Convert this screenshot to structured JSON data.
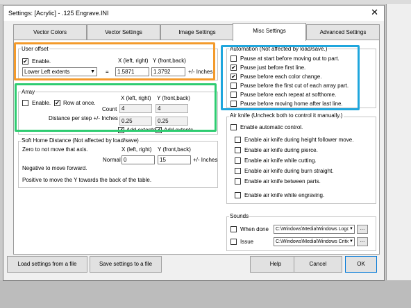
{
  "window": {
    "title": "Settings: [Acrylic] - .125 Engrave.INI",
    "close_glyph": "✕"
  },
  "tabs": [
    {
      "label": "Vector Colors",
      "active": false
    },
    {
      "label": "Vector Settings",
      "active": false
    },
    {
      "label": "Image Settings",
      "active": false
    },
    {
      "label": "Misc Settings",
      "active": true
    },
    {
      "label": "Advanced Settings",
      "active": false
    }
  ],
  "user_offset": {
    "title": "User offset",
    "enable_label": "Enable.",
    "enable_checked": true,
    "x_header": "X (left, right)",
    "y_header": "Y (front,back)",
    "mode_value": "Lower Left extents",
    "equals": "=",
    "x_value": "1.5871",
    "y_value": "1.3792",
    "units": "+/- Inches"
  },
  "array": {
    "title": "Array",
    "enable_label": "Enable.",
    "enable_checked": false,
    "row_label": "Row at once.",
    "row_checked": true,
    "x_header": "X (left, right)",
    "y_header": "Y (front,back)",
    "count_label": "Count",
    "count_x": "4",
    "count_y": "4",
    "distance_label": "Distance per step +/- Inches",
    "dist_x": "0.25",
    "dist_y": "0.25",
    "add_extents_x_label": "Add extents.",
    "add_extents_x_checked": true,
    "add_extents_y_label": "Add extents.",
    "add_extents_y_checked": true
  },
  "soft_home": {
    "title": "Soft Home Distance (Not affected by load/save)",
    "zero_note": "Zero to not move that axis.",
    "x_header": "X (left, right)",
    "y_header": "Y (front,back)",
    "normal_label": "Normal",
    "x_value": "0",
    "y_value": "15",
    "units": "+/- Inches",
    "negative_note": "Negative to move forward.",
    "positive_note": "Positive to move the Y towards the back of the table."
  },
  "automation": {
    "title": "Automation (Not affected by load/save.)",
    "items": [
      {
        "label": "Pause at start before moving out to part.",
        "checked": false
      },
      {
        "label": "Pause just before first line.",
        "checked": true
      },
      {
        "label": "Pause before each color change.",
        "checked": true
      },
      {
        "label": "Pause before the first cut of each array part.",
        "checked": false
      },
      {
        "label": "Pause before each repeat at softhome.",
        "checked": false
      },
      {
        "label": "Pause before moving home after last line.",
        "checked": false
      }
    ]
  },
  "air_knife": {
    "title": "Air knife (Uncheck both to control it manually.)",
    "auto_label": "Enable automatic control.",
    "auto_checked": false,
    "items": [
      {
        "label": "Enable air knife during height follower move.",
        "checked": false
      },
      {
        "label": "Enable air knife during pierce.",
        "checked": false
      },
      {
        "label": "Enable air knife while cutting.",
        "checked": false
      },
      {
        "label": "Enable air knife during burn straight.",
        "checked": false
      },
      {
        "label": "Enable air knife between parts.",
        "checked": false
      },
      {
        "label": "Enable air knife while engraving.",
        "checked": false
      }
    ]
  },
  "sounds": {
    "title": "Sounds",
    "done_label": "When done",
    "done_checked": false,
    "done_path": "C:\\Windows\\Media\\Windows Logo",
    "issue_label": "Issue",
    "issue_checked": false,
    "issue_path": "C:\\Windows\\Media\\Windows Critic",
    "browse": "..."
  },
  "buttons": {
    "load": "Load settings from a file",
    "save": "Save settings to a file",
    "help": "Help",
    "cancel": "Cancel",
    "ok": "OK"
  },
  "highlights": {
    "orange": "#f39a2b",
    "green": "#2ecc71",
    "blue": "#1fa6dd"
  },
  "check_glyph": "✔",
  "dropdown_glyph": "▼"
}
